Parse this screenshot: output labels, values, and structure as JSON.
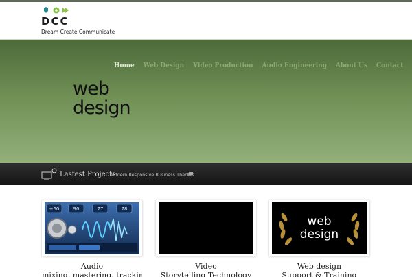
{
  "brand": {
    "name": "DCC",
    "tagline": "Dream Create Communicate"
  },
  "nav": {
    "items": [
      {
        "label": "Home",
        "active": true
      },
      {
        "label": "Web Design",
        "active": false
      },
      {
        "label": "Video Production",
        "active": false
      },
      {
        "label": "Audio Engineering",
        "active": false
      },
      {
        "label": "About Us",
        "active": false
      },
      {
        "label": "Contact",
        "active": false
      }
    ]
  },
  "hero": {
    "title": "web design"
  },
  "latest": {
    "label": "Lastest Projects:",
    "project": "Modern Responsive Business Themes"
  },
  "cards": [
    {
      "title": "Audio",
      "subtitle": "mixing, mastering, tracking"
    },
    {
      "title": "Video",
      "subtitle": "Storytelling Technology"
    },
    {
      "title": "Web design",
      "subtitle": "Support & Training"
    }
  ],
  "audio_panel": {
    "readouts": [
      "+60",
      "90",
      "77",
      "78"
    ]
  },
  "web_badge": {
    "text": "web design"
  },
  "colors": {
    "hero_top": "#4d6a3a",
    "hero_bottom": "#93b07a",
    "nav_active": "#dfe9d2",
    "nav_inactive": "#8fa974",
    "bar": "#1e1e1e"
  }
}
